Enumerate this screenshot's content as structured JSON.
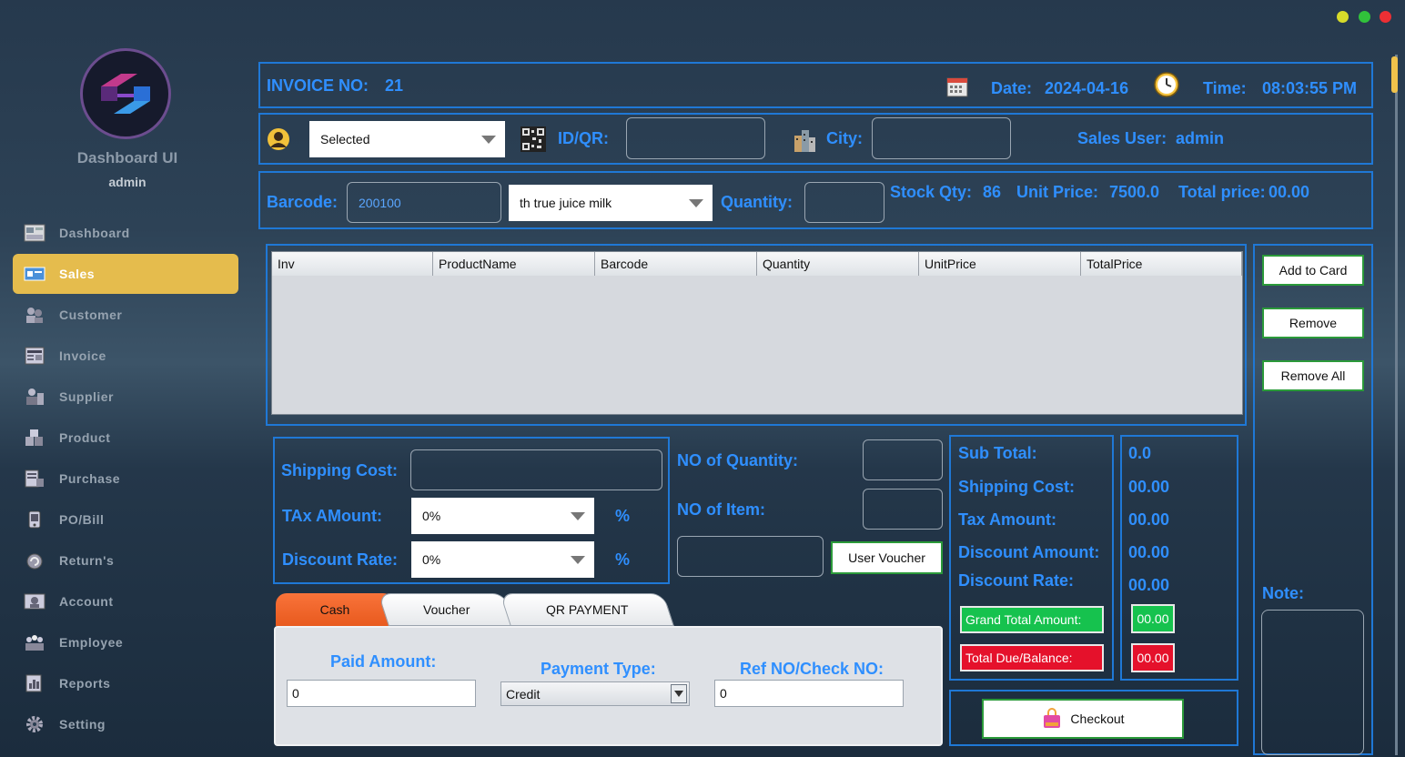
{
  "window": {
    "dots": [
      "#d7db2a",
      "#31c23b",
      "#ec2f34"
    ]
  },
  "sidebar": {
    "brand": "Dashboard UI",
    "user": "admin",
    "items": [
      {
        "label": "Dashboard",
        "icon": "dashboard-icon"
      },
      {
        "label": "Sales",
        "icon": "sales-icon"
      },
      {
        "label": "Customer",
        "icon": "customer-icon"
      },
      {
        "label": "Invoice",
        "icon": "invoice-icon"
      },
      {
        "label": "Supplier",
        "icon": "supplier-icon"
      },
      {
        "label": "Product",
        "icon": "product-icon"
      },
      {
        "label": "Purchase",
        "icon": "purchase-icon"
      },
      {
        "label": "PO/Bill",
        "icon": "po-bill-icon"
      },
      {
        "label": "Return's",
        "icon": "return-icon"
      },
      {
        "label": "Account",
        "icon": "account-icon"
      },
      {
        "label": "Employee",
        "icon": "employee-icon"
      },
      {
        "label": "Reports",
        "icon": "reports-icon"
      },
      {
        "label": "Setting",
        "icon": "setting-icon"
      }
    ],
    "active": "Sales"
  },
  "header": {
    "invoice_label": "INVOICE NO:",
    "invoice_no": "21",
    "date_label": "Date:",
    "date": "2024-04-16",
    "time_label": "Time:",
    "time": "08:03:55 PM"
  },
  "customer": {
    "select_value": "Selected",
    "idqr_label": "ID/QR:",
    "idqr_value": "",
    "city_label": "City:",
    "city_value": "",
    "sales_user_label": "Sales User:",
    "sales_user": "admin"
  },
  "product": {
    "barcode_label": "Barcode:",
    "barcode_value": "200100",
    "product_select": "th true juice milk",
    "quantity_label": "Quantity:",
    "quantity_value": "",
    "stock_label": "Stock Qty:",
    "stock_value": "86",
    "unit_price_label": "Unit Price:",
    "unit_price_value": "7500.0",
    "total_price_label": "Total price:",
    "total_price_value": "00.00"
  },
  "table": {
    "columns": [
      "Inv",
      "ProductName",
      "Barcode",
      "Quantity",
      "UnitPrice",
      "TotalPrice"
    ],
    "rows": []
  },
  "actions": {
    "add": "Add to Card",
    "remove": "Remove",
    "remove_all": "Remove All",
    "note_label": "Note:"
  },
  "costs": {
    "shipping_label": "Shipping Cost:",
    "shipping_value": "",
    "tax_label": "TAx AMount:",
    "tax_value": "0%",
    "discount_label": "Discount Rate:",
    "discount_value": "0%",
    "percent": "%"
  },
  "counts": {
    "qty_label": "NO of Quantity:",
    "qty_value": "",
    "item_label": "NO of Item:",
    "item_value": "",
    "voucher_value": "",
    "voucher_button": "User Voucher"
  },
  "summary": {
    "sub_total_label": "Sub Total:",
    "sub_total": "0.0",
    "shipping_label": "Shipping Cost:",
    "shipping": "00.00",
    "tax_label": "Tax Amount:",
    "tax": "00.00",
    "discount_amount_label": "Discount Amount:",
    "discount_amount": "00.00",
    "discount_rate_label": "Discount Rate:",
    "discount_rate": "00.00",
    "grand_total_label": "Grand Total Amount:",
    "grand_total": "00.00",
    "total_due_label": "Total Due/Balance:",
    "total_due": "00.00",
    "grand_color": "#16c24e",
    "due_color": "#e5112b"
  },
  "payment": {
    "tabs": [
      "Cash",
      "Voucher",
      "QR PAYMENT"
    ],
    "active_tab": "Cash",
    "paid_label": "Paid Amount:",
    "paid_value": "0",
    "type_label": "Payment Type:",
    "type_value": "Credit",
    "ref_label": "Ref NO/Check NO:",
    "ref_value": "0",
    "checkout": "Checkout"
  }
}
